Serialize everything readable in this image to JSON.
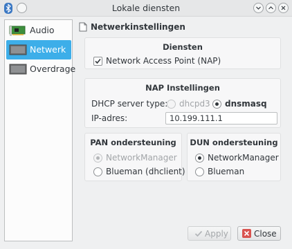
{
  "window": {
    "title": "Lokale diensten"
  },
  "sidebar": {
    "items": [
      {
        "label": "Audio",
        "icon": "audio-card-icon"
      },
      {
        "label": "Netwerk",
        "icon": "network-card-icon",
        "selected": true
      },
      {
        "label": "Overdrage",
        "icon": "network-card-icon"
      }
    ]
  },
  "page": {
    "title": "Netwerkinstellingen"
  },
  "services": {
    "title": "Diensten",
    "nap_label": "Network Access Point (NAP)",
    "nap_checked": true
  },
  "nap_settings": {
    "title": "NAP Instellingen",
    "dhcp_label": "DHCP server type:",
    "dhcp_options": [
      {
        "label": "dhcpd3",
        "selected": false,
        "enabled": false
      },
      {
        "label": "dnsmasq",
        "selected": true,
        "enabled": true
      }
    ],
    "ip_label": "IP-adres:",
    "ip_value": "10.199.111.1"
  },
  "pan": {
    "title": "PAN ondersteuning",
    "options": [
      {
        "label": "NetworkManager",
        "selected": true,
        "enabled": false
      },
      {
        "label": "Blueman (dhclient)",
        "selected": false,
        "enabled": true
      }
    ]
  },
  "dun": {
    "title": "DUN ondersteuning",
    "options": [
      {
        "label": "NetworkManager",
        "selected": true,
        "enabled": true
      },
      {
        "label": "Blueman",
        "selected": false,
        "enabled": true
      }
    ]
  },
  "buttons": {
    "apply": "Apply",
    "close": "Close"
  }
}
